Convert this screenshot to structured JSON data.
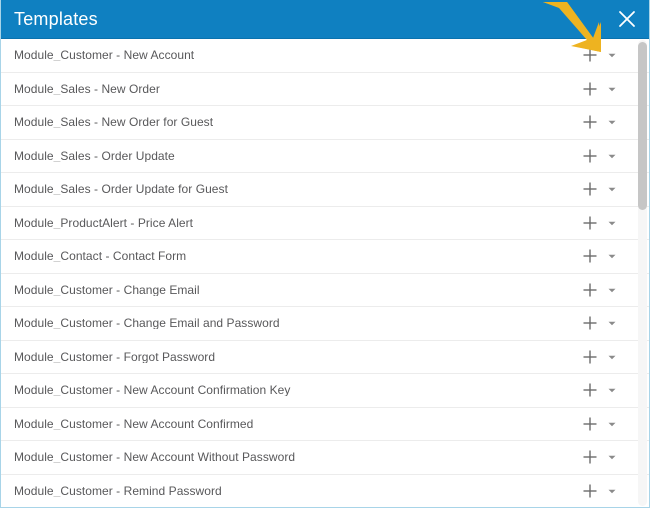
{
  "header": {
    "title": "Templates",
    "background_color": "#0f80c1",
    "title_color": "#ffffff",
    "close_label": "×"
  },
  "annotation": {
    "type": "arrow",
    "color": "#eeb320",
    "points_to": "add-button-row-1"
  },
  "list": {
    "row_action_add_label": "+",
    "row_action_menu_label": "▾",
    "items": [
      {
        "label": "Module_Customer - New Account"
      },
      {
        "label": "Module_Sales - New Order"
      },
      {
        "label": "Module_Sales - New Order for Guest"
      },
      {
        "label": "Module_Sales - Order Update"
      },
      {
        "label": "Module_Sales - Order Update for Guest"
      },
      {
        "label": "Module_ProductAlert - Price Alert"
      },
      {
        "label": "Module_Contact - Contact Form"
      },
      {
        "label": "Module_Customer - Change Email"
      },
      {
        "label": "Module_Customer - Change Email and Password"
      },
      {
        "label": "Module_Customer - Forgot Password"
      },
      {
        "label": "Module_Customer - New Account Confirmation Key"
      },
      {
        "label": "Module_Customer - New Account Confirmed"
      },
      {
        "label": "Module_Customer - New Account Without Password"
      },
      {
        "label": "Module_Customer - Remind Password"
      }
    ]
  },
  "scrollbar": {
    "orientation": "vertical",
    "thumb_color": "#c6c6c6",
    "track_color": "#f6f6f6"
  }
}
